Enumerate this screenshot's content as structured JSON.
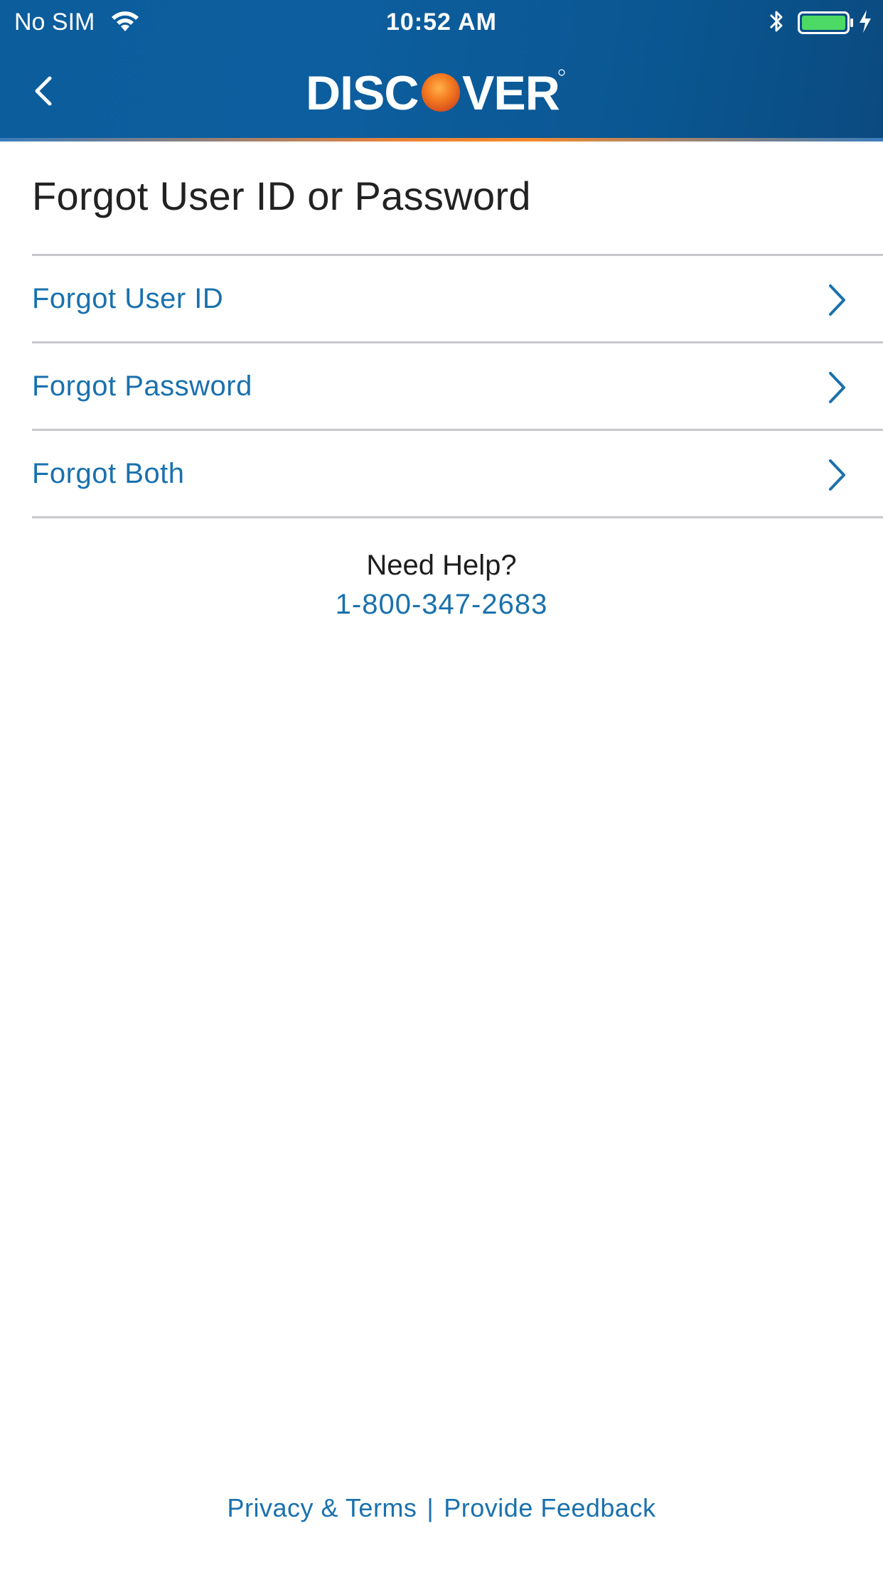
{
  "status_bar": {
    "carrier": "No SIM",
    "time": "10:52 AM",
    "icons": [
      "wifi-icon",
      "bluetooth-icon",
      "battery-icon",
      "charging-bolt-icon"
    ]
  },
  "header": {
    "back_icon": "chevron-left-icon",
    "logo_text": "DISCOVER",
    "brand_color": "#0b5d9c",
    "accent_color": "#f3892f"
  },
  "page": {
    "title": "Forgot User ID or Password"
  },
  "options": [
    {
      "label": "Forgot User ID",
      "icon": "chevron-right-icon"
    },
    {
      "label": "Forgot Password",
      "icon": "chevron-right-icon"
    },
    {
      "label": "Forgot Both",
      "icon": "chevron-right-icon"
    }
  ],
  "help": {
    "title": "Need Help?",
    "phone": "1-800-347-2683"
  },
  "footer": {
    "privacy_label": "Privacy & Terms",
    "separator": "|",
    "feedback_label": "Provide Feedback"
  },
  "colors": {
    "link": "#1a71ad",
    "divider": "#c7c7cc",
    "text": "#222222"
  }
}
